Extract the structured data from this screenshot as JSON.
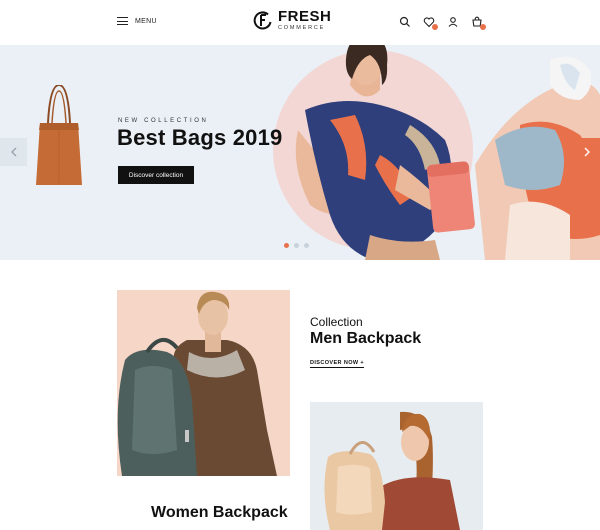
{
  "header": {
    "menu_label": "MENU",
    "logo": {
      "name": "FRESH",
      "sub": "COMMERCE"
    },
    "icons": [
      "search-icon",
      "heart-icon",
      "user-icon",
      "cart-icon"
    ]
  },
  "hero": {
    "eyebrow": "NEW COLLECTION",
    "title": "Best Bags 2019",
    "button_label": "Discover collection",
    "slides": 3,
    "active_slide": 1,
    "colors": {
      "background": "#eaf0f6",
      "accent": "#e8704b",
      "circle": "#f3d7d5"
    }
  },
  "collections": {
    "men": {
      "label": "Collection",
      "title": "Men Backpack",
      "link": "DISCOVER NOW +"
    },
    "women": {
      "title": "Women Backpack",
      "subtitle": ""
    }
  }
}
